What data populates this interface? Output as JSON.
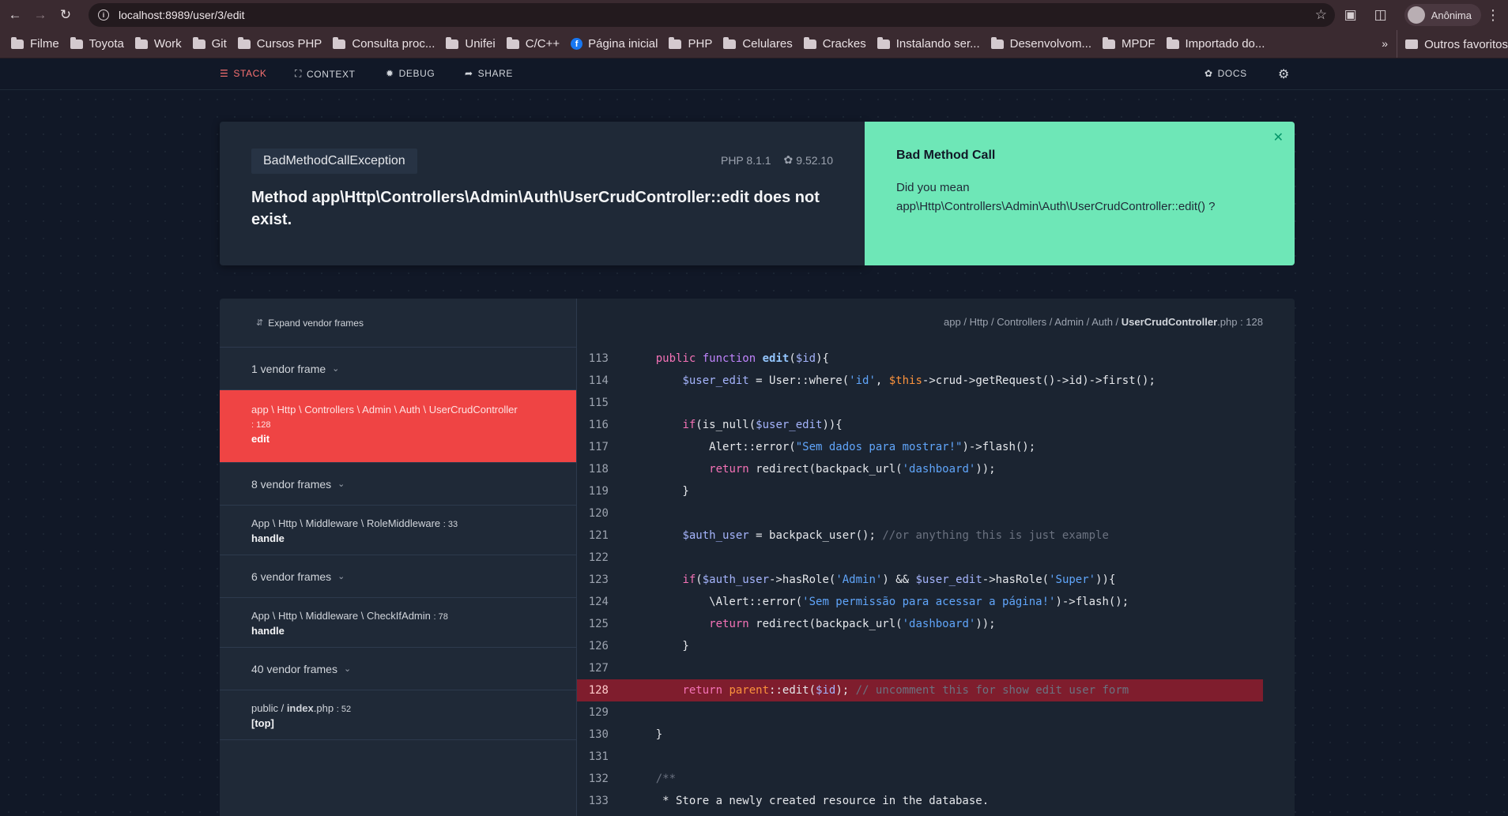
{
  "browser": {
    "url": "localhost:8989/user/3/edit",
    "profile_name": "Anônima",
    "bookmarks": [
      {
        "label": "Filme",
        "icon": "folder-icon"
      },
      {
        "label": "Toyota",
        "icon": "folder-icon"
      },
      {
        "label": "Work",
        "icon": "folder-icon"
      },
      {
        "label": "Git",
        "icon": "folder-icon"
      },
      {
        "label": "Cursos PHP",
        "icon": "folder-icon"
      },
      {
        "label": "Consulta proc...",
        "icon": "folder-icon"
      },
      {
        "label": "Unifei",
        "icon": "folder-icon"
      },
      {
        "label": "C/C++",
        "icon": "folder-icon"
      },
      {
        "label": "Página inicial",
        "icon": "facebook-icon"
      },
      {
        "label": "PHP",
        "icon": "folder-icon"
      },
      {
        "label": "Celulares",
        "icon": "folder-icon"
      },
      {
        "label": "Crackes",
        "icon": "folder-icon"
      },
      {
        "label": "Instalando ser...",
        "icon": "folder-icon"
      },
      {
        "label": "Desenvolvom...",
        "icon": "folder-icon"
      },
      {
        "label": "MPDF",
        "icon": "folder-icon"
      },
      {
        "label": "Importado do...",
        "icon": "folder-icon"
      }
    ],
    "more_label": "»",
    "other_favorites": "Outros favoritos"
  },
  "header": {
    "tabs": [
      {
        "label": "STACK",
        "icon": "list-icon",
        "active": true
      },
      {
        "label": "CONTEXT",
        "icon": "expand-icon",
        "active": false
      },
      {
        "label": "DEBUG",
        "icon": "bug-icon",
        "active": false
      },
      {
        "label": "SHARE",
        "icon": "share-icon",
        "active": false
      }
    ],
    "docs_label": "DOCS"
  },
  "exception": {
    "class": "BadMethodCallException",
    "php_version": "PHP 8.1.1",
    "laravel_version": "9.52.10",
    "message": "Method app\\Http\\Controllers\\Admin\\Auth\\UserCrudController::edit does not exist."
  },
  "solution": {
    "title": "Bad Method Call",
    "body_line1": "Did you mean",
    "body_line2": "app\\Http\\Controllers\\Admin\\Auth\\UserCrudController::edit() ?"
  },
  "stack": {
    "expand_label": "Expand vendor frames",
    "vendor_1": "1 vendor frame",
    "frame_active": {
      "path": "app \\ Http \\ Controllers \\ Admin \\ Auth \\ UserCrudController",
      "line": ": 128",
      "method": "edit"
    },
    "vendor_2": "8 vendor frames",
    "frame_2": {
      "path": "App \\ Http \\ Middleware \\ RoleMiddleware",
      "line": ": 33",
      "method": "handle"
    },
    "vendor_3": "6 vendor frames",
    "frame_3": {
      "path": "App \\ Http \\ Middleware \\ CheckIfAdmin",
      "line": ": 78",
      "method": "handle"
    },
    "vendor_4": "40 vendor frames",
    "frame_4": {
      "path_prefix": "public / ",
      "path_file": "index",
      "path_ext": ".php",
      "line": ": 52",
      "method": "[top]"
    }
  },
  "code": {
    "file_path_prefix": "app / Http / Controllers / Admin / Auth / ",
    "file_name": "UserCrudController",
    "file_ext": ".php",
    "file_line": ": 128",
    "highlight_line": 128,
    "lines": [
      {
        "n": "113",
        "html": "    <span class='kw'>public</span> <span class='kw2'>function</span> <span class='fn'>edit</span>(<span class='var'>$id</span>){"
      },
      {
        "n": "114",
        "html": "        <span class='var'>$user_edit</span> = User::where(<span class='str'>'id'</span>, <span class='par'>$this</span>->crud->getRequest()->id)->first();"
      },
      {
        "n": "115",
        "html": ""
      },
      {
        "n": "116",
        "html": "        <span class='kw'>if</span>(is_null(<span class='var'>$user_edit</span>)){"
      },
      {
        "n": "117",
        "html": "            Alert::error(<span class='str'>\"Sem dados para mostrar!\"</span>)->flash();"
      },
      {
        "n": "118",
        "html": "            <span class='ret'>return</span> redirect(backpack_url(<span class='str'>'dashboard'</span>));"
      },
      {
        "n": "119",
        "html": "        }"
      },
      {
        "n": "120",
        "html": ""
      },
      {
        "n": "121",
        "html": "        <span class='var'>$auth_user</span> = backpack_user(); <span class='cm'>//or anything this is just example</span>"
      },
      {
        "n": "122",
        "html": ""
      },
      {
        "n": "123",
        "html": "        <span class='kw'>if</span>(<span class='var'>$auth_user</span>->hasRole(<span class='str'>'Admin'</span>) && <span class='var'>$user_edit</span>->hasRole(<span class='str'>'Super'</span>)){"
      },
      {
        "n": "124",
        "html": "            \\Alert::error(<span class='str'>'Sem permissão para acessar a página!'</span>)->flash();"
      },
      {
        "n": "125",
        "html": "            <span class='ret'>return</span> redirect(backpack_url(<span class='str'>'dashboard'</span>));"
      },
      {
        "n": "126",
        "html": "        }"
      },
      {
        "n": "127",
        "html": ""
      },
      {
        "n": "128",
        "html": "        <span class='ret'>return</span> <span class='par'>parent</span>::edit(<span class='var'>$id</span>); <span class='cm'>// uncomment this for show edit user form</span>"
      },
      {
        "n": "129",
        "html": ""
      },
      {
        "n": "130",
        "html": "    }"
      },
      {
        "n": "131",
        "html": ""
      },
      {
        "n": "132",
        "html": "    <span class='cm'>/**</span>"
      },
      {
        "n": "133",
        "html": "     * Store a newly created resource in the database."
      }
    ]
  },
  "colors": {
    "accent_red": "#ef4444",
    "solution_green": "#6ee7b7",
    "background": "#111827"
  }
}
